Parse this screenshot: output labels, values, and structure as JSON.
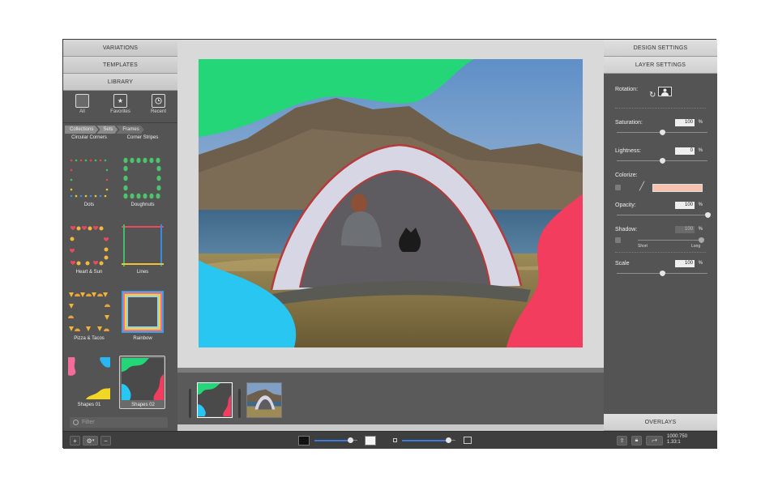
{
  "left_panel": {
    "tabs": [
      "VARIATIONS",
      "TEMPLATES",
      "LIBRARY"
    ],
    "library_icons": [
      {
        "label": "All",
        "icon": "square-icon"
      },
      {
        "label": "Favorites",
        "icon": "star-icon"
      },
      {
        "label": "Recent",
        "icon": "clock-icon"
      }
    ],
    "breadcrumbs": [
      "Collections",
      "Sets",
      "Frames"
    ],
    "frame_sets": [
      {
        "label": "Circular Corners"
      },
      {
        "label": "Corner Stripes"
      },
      {
        "label": "Dots"
      },
      {
        "label": "Doughnuts"
      },
      {
        "label": "Heart & Sun"
      },
      {
        "label": "Lines"
      },
      {
        "label": "Pizza & Tacos"
      },
      {
        "label": "Rainbow"
      },
      {
        "label": "Shapes 01"
      },
      {
        "label": "Shapes 02",
        "selected": true
      }
    ],
    "filter_placeholder": "Filter"
  },
  "right_panel": {
    "tabs": [
      "DESIGN SETTINGS",
      "LAYER SETTINGS"
    ],
    "rotation_label": "Rotation:",
    "saturation": {
      "label": "Saturation:",
      "value": "100",
      "unit": "%",
      "level": 0.5
    },
    "lightness": {
      "label": "Lightness:",
      "value": "0",
      "unit": "%",
      "level": 0.5
    },
    "colorize": {
      "label": "Colorize:",
      "swatch": "#f7c3ae"
    },
    "opacity": {
      "label": "Opacity:",
      "value": "100",
      "unit": "%",
      "level": 1.0
    },
    "shadow": {
      "label": "Shadow:",
      "value": "100",
      "unit": "%",
      "short_label": "Short",
      "long_label": "Long",
      "level": 1.0
    },
    "scale": {
      "label": "Scale",
      "value": "100",
      "unit": "%",
      "level": 0.5
    },
    "overlays_tab": "OVERLAYS"
  },
  "bottom_bar": {
    "add_label": "+",
    "remove_label": "−",
    "dimensions": "1000:750",
    "ratio": "1.33:1",
    "zoom_level": 0.85,
    "thumb_size_level": 0.85
  },
  "colors": {
    "accent": "#3a7be0",
    "shape_green": "#24d678",
    "shape_cyan": "#29c6f2",
    "shape_red": "#f23d5e",
    "shape_pink": "#f56b9a",
    "shape_yellow": "#f2d624"
  }
}
